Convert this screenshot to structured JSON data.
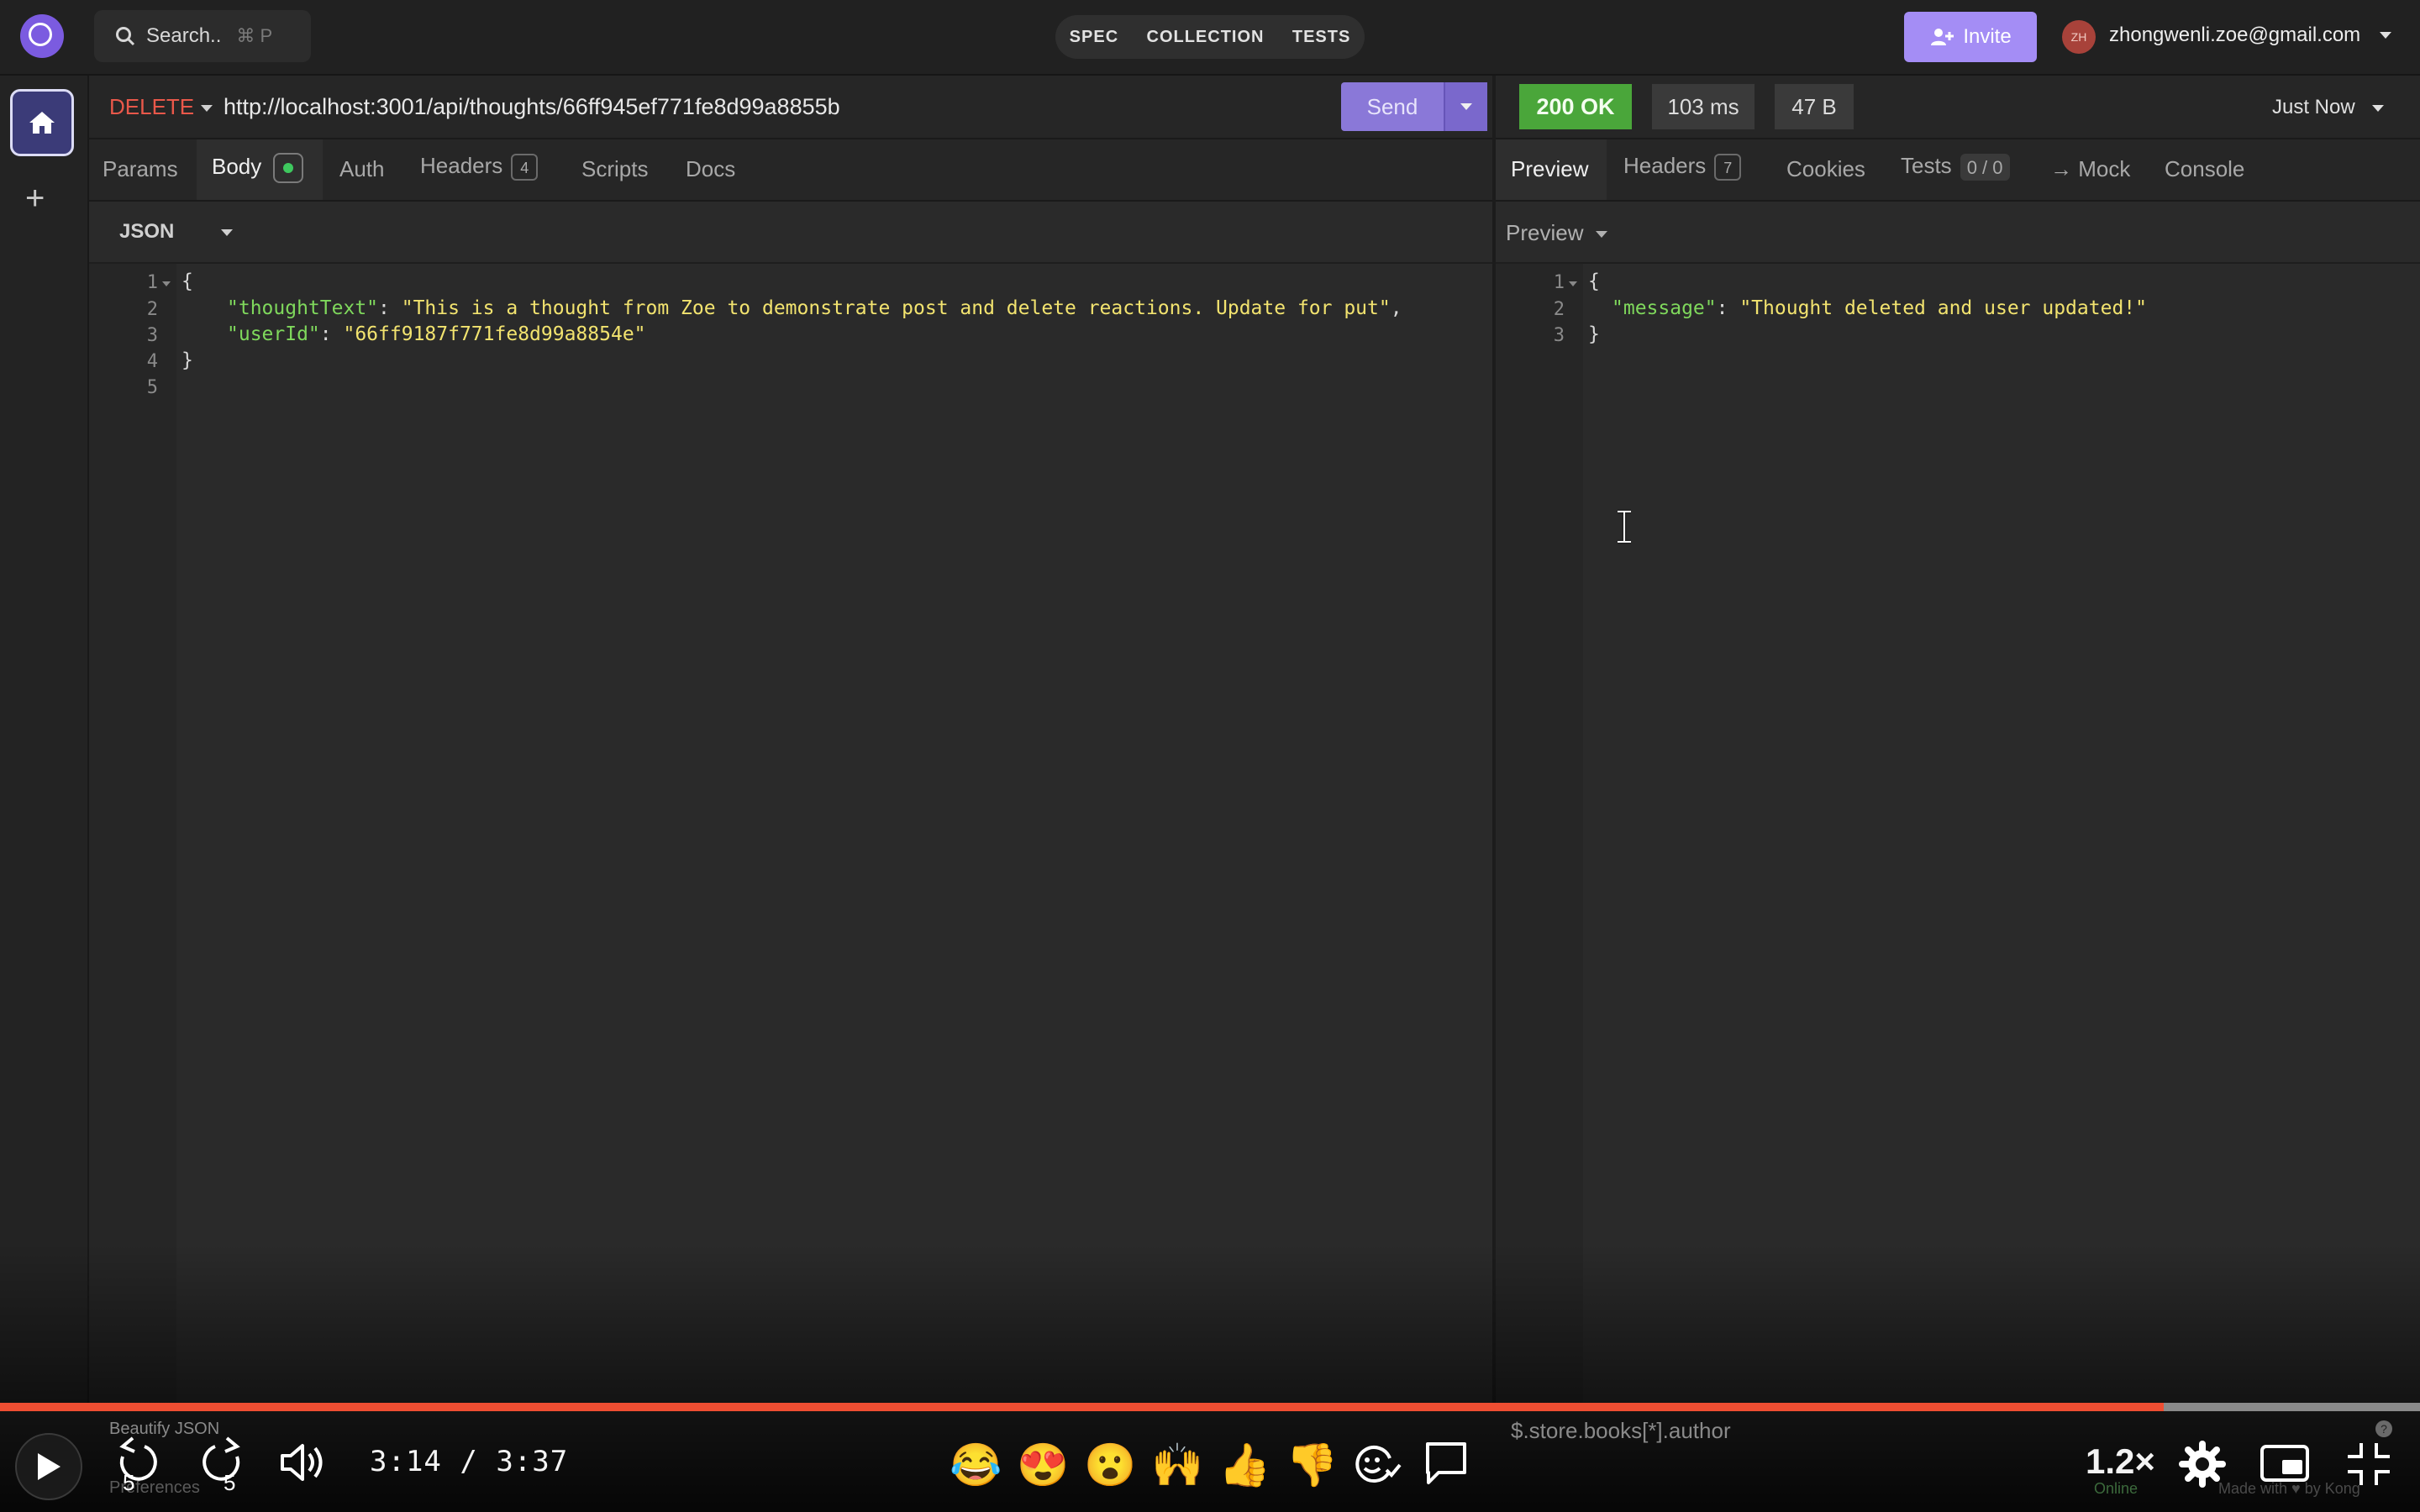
{
  "topbar": {
    "search_label": "Search..",
    "search_shortcut": "⌘ P",
    "modes": [
      "SPEC",
      "COLLECTION",
      "TESTS"
    ],
    "invite_label": "Invite",
    "avatar_initials": "ZH",
    "user_email": "zhongwenli.zoe@gmail.com"
  },
  "request": {
    "method": "DELETE",
    "url": "http://localhost:3001/api/thoughts/66ff945ef771fe8d99a8855b",
    "send_label": "Send",
    "tabs": {
      "params": "Params",
      "body": "Body",
      "auth": "Auth",
      "headers": "Headers",
      "headers_count": "4",
      "scripts": "Scripts",
      "docs": "Docs"
    },
    "body_format": "JSON",
    "body_lines": {
      "n1": "1",
      "n2": "2",
      "n3": "3",
      "n4": "4",
      "n5": "5",
      "open": "{",
      "key1": "\"thoughtText\"",
      "val1": "\"This is a thought from Zoe to demonstrate post and delete reactions. Update for put\"",
      "key2": "\"userId\"",
      "val2": "\"66ff9187f771fe8d99a8854e\"",
      "close": "}"
    },
    "footer_action": "Beautify JSON",
    "preferences_label": "Preferences"
  },
  "response": {
    "status": "200 OK",
    "time": "103 ms",
    "size": "47 B",
    "timestamp": "Just Now",
    "tabs": {
      "preview": "Preview",
      "headers": "Headers",
      "headers_count": "7",
      "cookies": "Cookies",
      "tests": "Tests",
      "tests_count": "0 / 0",
      "mock": "→ Mock",
      "console": "Console"
    },
    "preview_mode": "Preview",
    "body_lines": {
      "n1": "1",
      "n2": "2",
      "n3": "3",
      "open": "{",
      "key1": "\"message\"",
      "val1": "\"Thought deleted and user updated!\"",
      "close": "}"
    },
    "filter_placeholder": "$.store.books[*].author",
    "online_label": "Online",
    "made_with": "Made with ♥ by Kong"
  },
  "player": {
    "time_current": "3:14",
    "time_total": "3:37",
    "progress": 0.894,
    "skip_back_seconds": "5",
    "skip_forward_seconds": "5",
    "speed": "1.2×",
    "reactions": [
      "😂",
      "😍",
      "😮",
      "🙌",
      "👍",
      "👎"
    ]
  },
  "colors": {
    "accent": "#8a78d8",
    "status_ok": "#4aa63a",
    "method_delete": "#e9584a",
    "json_key": "#7fd85c",
    "json_string": "#f2e36f",
    "progress": "#ee4e32"
  }
}
